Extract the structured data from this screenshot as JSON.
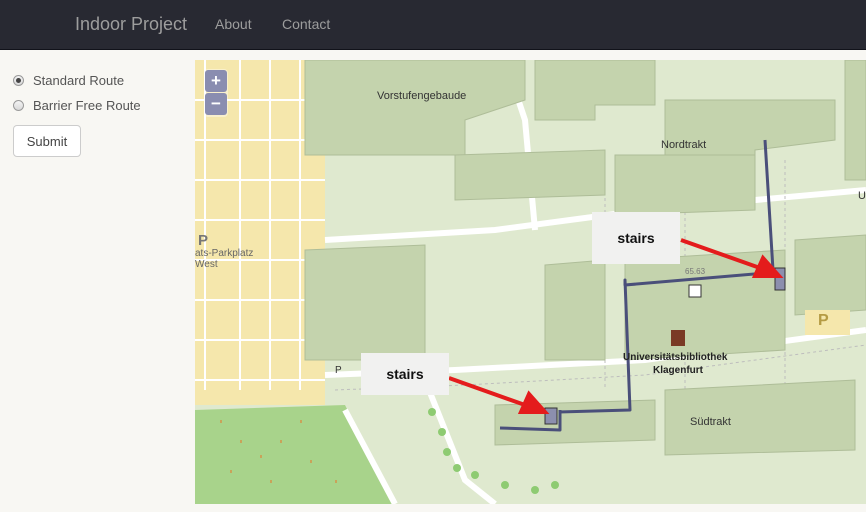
{
  "nav": {
    "brand": "Indoor Project",
    "links": [
      "About",
      "Contact"
    ]
  },
  "sidebar": {
    "options": [
      {
        "label": "Standard Route",
        "checked": true
      },
      {
        "label": "Barrier Free Route",
        "checked": false
      }
    ],
    "submit_label": "Submit"
  },
  "map": {
    "zoom_in": "+",
    "zoom_out": "−",
    "annotations": [
      "stairs",
      "stairs"
    ],
    "places": {
      "vorstufengebaude": "Vorstufengebaude",
      "nordtrakt": "Nordtrakt",
      "sudtrakt": "Südtrakt",
      "library_line1": "Universitätsbibliothek",
      "library_line2": "Klagenfurt",
      "parking_line1": "ats-Parkplatz",
      "parking_line2": "West",
      "parking_p_left": "P",
      "parking_p_right": "P",
      "height_mark": "65.63",
      "edge_u": "U",
      "edge_p": "P"
    },
    "colors": {
      "route": "#4a4f7a",
      "arrow": "#e41c1c",
      "parking": "#f5e7ac",
      "grass": "#cfe2b8",
      "campus": "#dfe9cf",
      "building": "#c4d3ad",
      "park": "#a8d38b"
    }
  }
}
